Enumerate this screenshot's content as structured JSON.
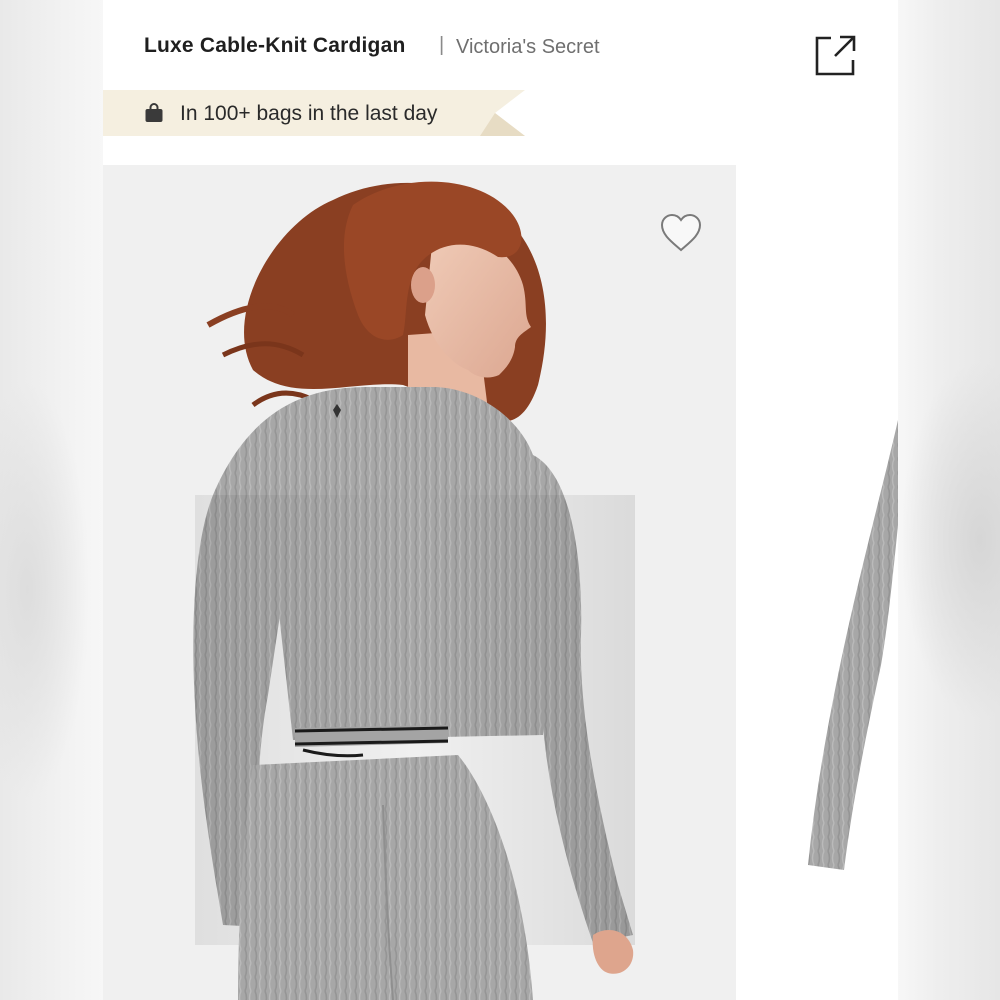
{
  "header": {
    "title": "Luxe Cable-Knit Cardigan",
    "separator": "|",
    "brand": "Victoria's Secret",
    "share_icon": "share-icon"
  },
  "promo": {
    "text": "In 100+ bags in the last day",
    "icon": "shopping-bag-icon",
    "background": "#f5efe0"
  },
  "gallery": {
    "favorite_icon": "heart-outline-icon",
    "photo_subject": "model wearing grey cable-knit cardigan, back view",
    "product_color": "#a9a9a9"
  },
  "colors": {
    "text_primary": "#1f1f1f",
    "text_secondary": "#6f6f6f",
    "photo_background": "#f0f0f0"
  }
}
